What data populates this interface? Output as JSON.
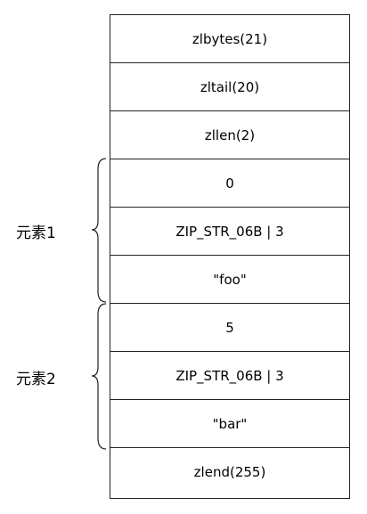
{
  "cells": [
    "zlbytes(21)",
    "zltail(20)",
    "zllen(2)",
    "0",
    "ZIP_STR_06B | 3",
    "\"foo\"",
    "5",
    "ZIP_STR_06B | 3",
    "\"bar\"",
    "zlend(255)"
  ],
  "groups": [
    {
      "label": "元素1"
    },
    {
      "label": "元素2"
    }
  ]
}
